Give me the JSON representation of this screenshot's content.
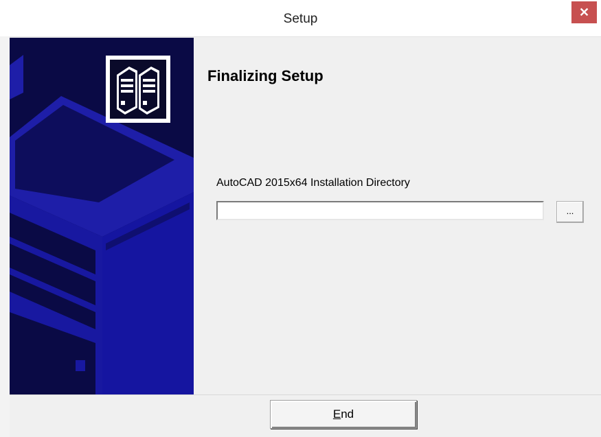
{
  "window": {
    "title": "Setup",
    "close_glyph": "✕"
  },
  "main": {
    "heading": "Finalizing Setup",
    "dir_label": "AutoCAD 2015x64 Installation Directory",
    "dir_value": "",
    "browse_label": "...",
    "end_label_mnemonic": "E",
    "end_label_rest": "nd"
  },
  "icons": {
    "side_art": "server-tower-illustration-icon",
    "logo": "servers-logo-icon",
    "close": "close-icon"
  },
  "colors": {
    "side_bg": "#0a0a45",
    "side_shape": "#1e1ea8",
    "close_bg": "#c75050"
  }
}
